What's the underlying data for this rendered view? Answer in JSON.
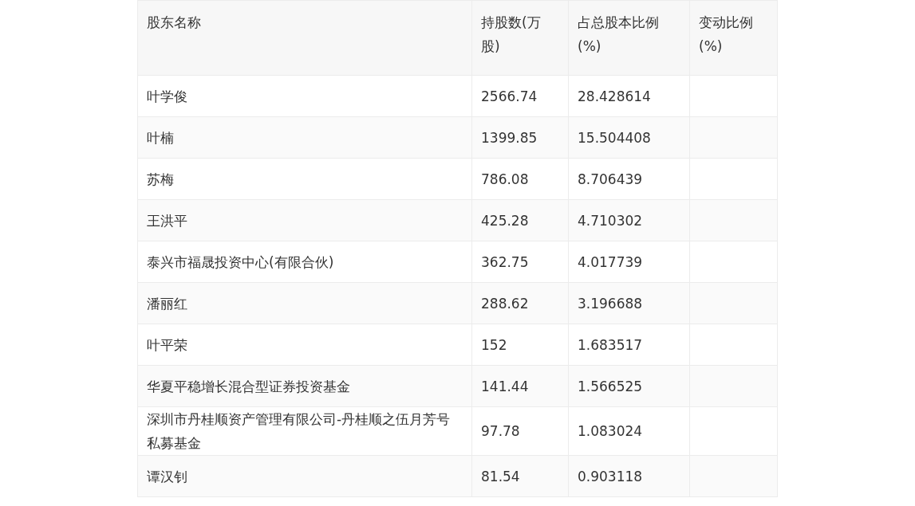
{
  "table": {
    "columns": [
      "股东名称",
      "持股数(万股)",
      "占总股本比例(%)",
      "变动比例(%)"
    ],
    "rows": [
      {
        "name": "叶学俊",
        "shares": "2566.74",
        "ratio": "28.428614"
      },
      {
        "name": "叶楠",
        "shares": "1399.85",
        "ratio": "15.504408"
      },
      {
        "name": "苏梅",
        "shares": "786.08",
        "ratio": "8.706439"
      },
      {
        "name": "王洪平",
        "shares": "425.28",
        "ratio": "4.710302"
      },
      {
        "name": "泰兴市福晟投资中心(有限合伙)",
        "shares": "362.75",
        "ratio": "4.017739"
      },
      {
        "name": "潘丽红",
        "shares": "288.62",
        "ratio": "3.196688"
      },
      {
        "name": "叶平荣",
        "shares": "152",
        "ratio": "1.683517"
      },
      {
        "name": "华夏平稳增长混合型证券投资基金",
        "shares": "141.44",
        "ratio": "1.566525"
      },
      {
        "name": "深圳市丹桂顺资产管理有限公司-丹桂顺之伍月芳号私募基金",
        "shares": "97.78",
        "ratio": "1.083024"
      },
      {
        "name": "谭汉钊",
        "shares": "81.54",
        "ratio": "0.903118"
      }
    ]
  }
}
